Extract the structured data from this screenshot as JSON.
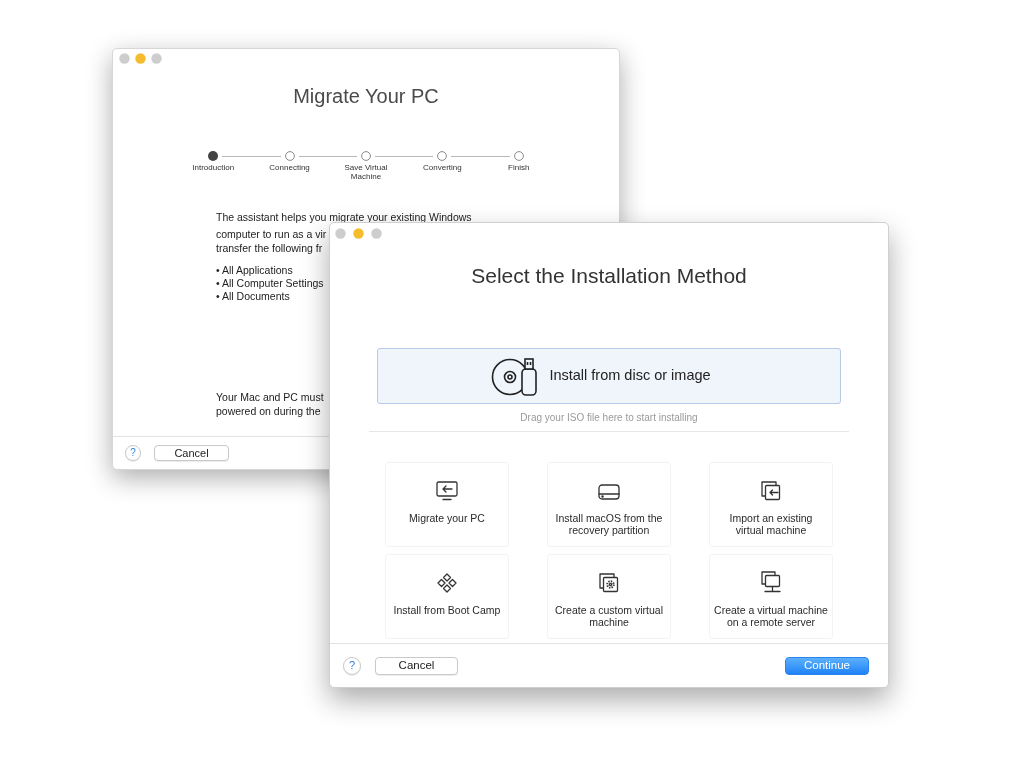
{
  "migrate_window": {
    "title": "Migrate Your PC",
    "steps": [
      {
        "label": "Introduction",
        "selected": true
      },
      {
        "label": "Connecting",
        "selected": false
      },
      {
        "label": "Save Virtual\nMachine",
        "selected": false
      },
      {
        "label": "Converting",
        "selected": false
      },
      {
        "label": "Finish",
        "selected": false
      }
    ],
    "intro_lines": [
      "The assistant helps you migrate your existing Windows",
      "computer to run as a vir",
      "transfer the following fr"
    ],
    "bullets": [
      "• All Applications",
      "• All Computer Settings",
      "• All Documents"
    ],
    "note_lines": [
      "Your Mac and PC must",
      "powered on during the"
    ],
    "buttons": [
      {
        "kind": "help",
        "label": "?"
      },
      {
        "kind": "secondary",
        "label": "Cancel"
      }
    ]
  },
  "install_window": {
    "title": "Select the Installation Method",
    "primary_option": {
      "label": "Install from disc or image",
      "selected": true
    },
    "hint": "Drag your ISO file here to start installing",
    "options": [
      {
        "label": "Migrate your PC",
        "selected": false
      },
      {
        "label": "Install macOS from the\nrecovery partition",
        "selected": false
      },
      {
        "label": "Import an existing\nvirtual machine",
        "selected": false
      },
      {
        "label": "Install from Boot Camp",
        "selected": false
      },
      {
        "label": "Create a custom virtual\nmachine",
        "selected": false
      },
      {
        "label": "Create a virtual machine\non a remote server",
        "selected": false
      }
    ],
    "buttons": [
      {
        "kind": "help",
        "label": "?"
      },
      {
        "kind": "secondary",
        "label": "Cancel"
      },
      {
        "kind": "primary",
        "label": "Continue"
      }
    ]
  }
}
